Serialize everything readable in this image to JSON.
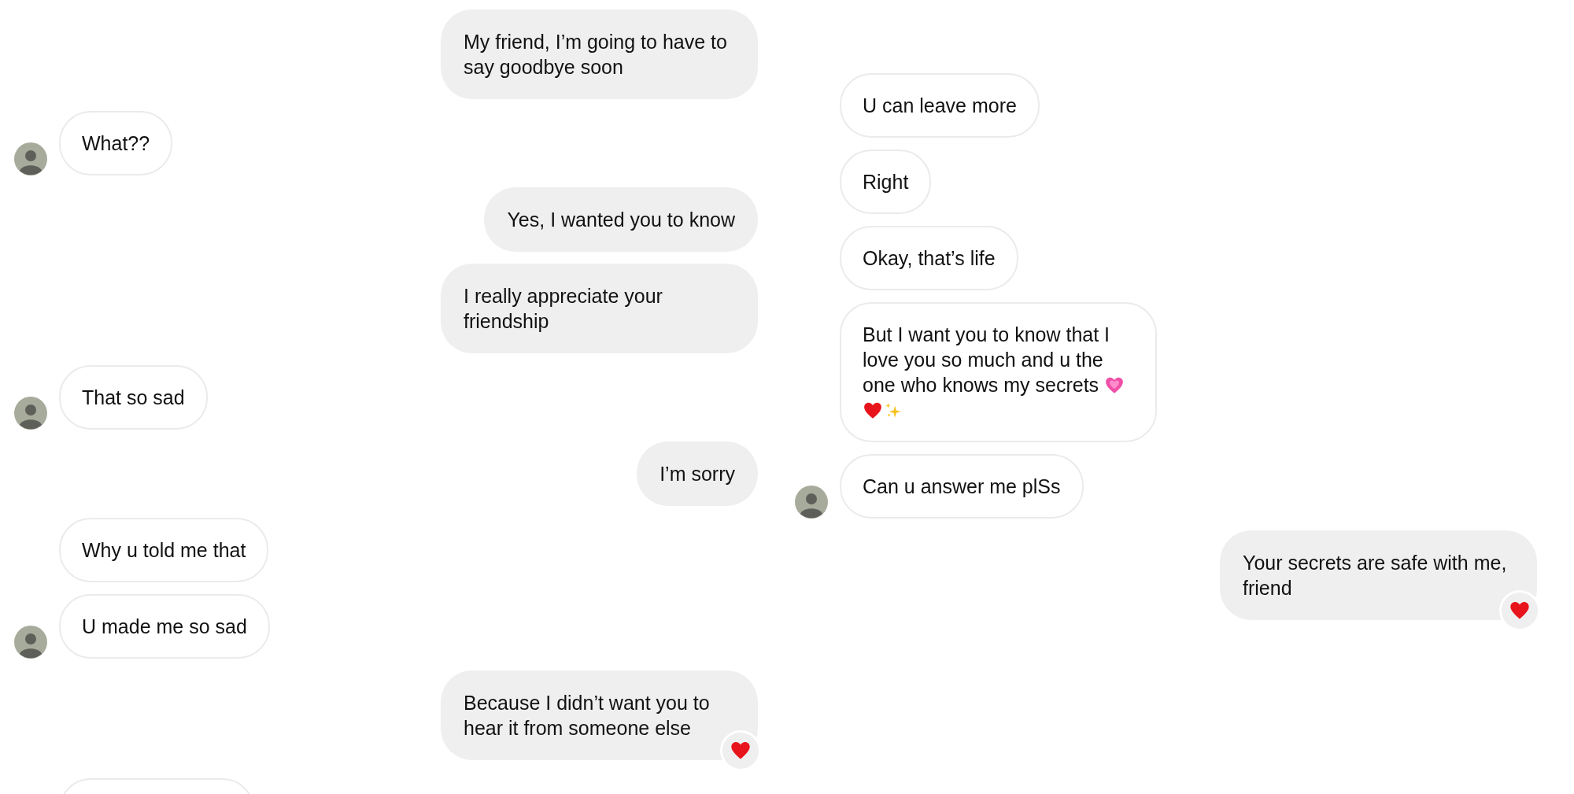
{
  "columns": [
    {
      "messages": [
        {
          "kind": "sent",
          "text": "My friend, I’m going to have to say goodbye soon",
          "reacted": false
        },
        {
          "kind": "received",
          "text": "What??",
          "avatar": true
        },
        {
          "kind": "sent",
          "text": "Yes, I wanted you to know",
          "reacted": false
        },
        {
          "kind": "sent",
          "text": "I really appreciate your friendship",
          "reacted": false
        },
        {
          "kind": "received",
          "text": "That so sad",
          "avatar": true
        },
        {
          "kind": "sent",
          "text": "I’m sorry",
          "reacted": false
        },
        {
          "kind": "received",
          "text": "Why u told me that",
          "avatar": false
        },
        {
          "kind": "received",
          "text": "U made me so sad",
          "avatar": true
        },
        {
          "kind": "sent",
          "text": "Because I didn’t want you to hear it from someone else",
          "reacted": true
        },
        {
          "kind": "received_cut"
        }
      ]
    },
    {
      "messages": [
        {
          "kind": "received",
          "text": "U can leave more",
          "avatar": false
        },
        {
          "kind": "received",
          "text": "Right",
          "avatar": false
        },
        {
          "kind": "received",
          "text": "Okay, that’s life",
          "avatar": false
        },
        {
          "kind": "received",
          "text": "But I want you to know that I love you so much and u the one who knows my secrets",
          "emojis": [
            {
              "kind": "pink_heart"
            },
            {
              "kind": "red_heart"
            },
            {
              "kind": "sparkles"
            }
          ],
          "avatar": false
        },
        {
          "kind": "received",
          "text": "Can u answer me plSs",
          "avatar": true
        },
        {
          "kind": "sent",
          "text": "Your secrets are safe with me, friend",
          "reacted": true
        }
      ]
    }
  ]
}
